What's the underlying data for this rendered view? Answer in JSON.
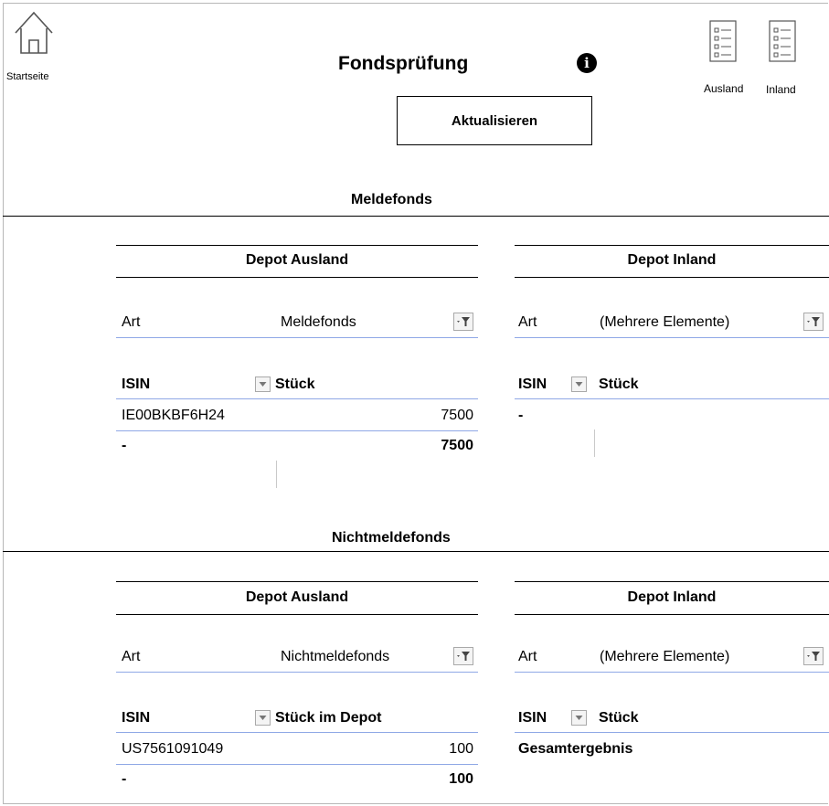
{
  "header": {
    "home_label": "Startseite",
    "title": "Fondsprüfung",
    "info_glyph": "i",
    "refresh_label": "Aktualisieren",
    "docs": [
      {
        "label": "Ausland",
        "icon": "list-document-icon"
      },
      {
        "label": "Inland",
        "icon": "list-document-icon"
      }
    ]
  },
  "sections": [
    {
      "title": "Meldefonds",
      "ausland": {
        "header": "Depot Ausland",
        "filter_label": "Art",
        "filter_value": "Meldefonds",
        "col1": "ISIN",
        "col2": "Stück",
        "rows": [
          {
            "isin": "IE00BKBF6H24",
            "qty": "7500"
          }
        ],
        "total_label": "-",
        "total_value": "7500"
      },
      "inland": {
        "header": "Depot Inland",
        "filter_label": "Art",
        "filter_value": "(Mehrere Elemente)",
        "col1": "ISIN",
        "col2": "Stück",
        "row_text": "-"
      }
    },
    {
      "title": "Nichtmeldefonds",
      "ausland": {
        "header": "Depot Ausland",
        "filter_label": "Art",
        "filter_value": "Nichtmeldefonds",
        "col1": "ISIN",
        "col2": "Stück im Depot",
        "rows": [
          {
            "isin": "US7561091049",
            "qty": "100"
          }
        ],
        "total_label": "-",
        "total_value": "100"
      },
      "inland": {
        "header": "Depot Inland",
        "filter_label": "Art",
        "filter_value": "(Mehrere Elemente)",
        "col1": "ISIN",
        "col2": "Stück",
        "row_text": "Gesamtergebnis"
      }
    }
  ],
  "colors": {
    "accent_line": "#8fa8e6",
    "info_bg": "#000000"
  }
}
